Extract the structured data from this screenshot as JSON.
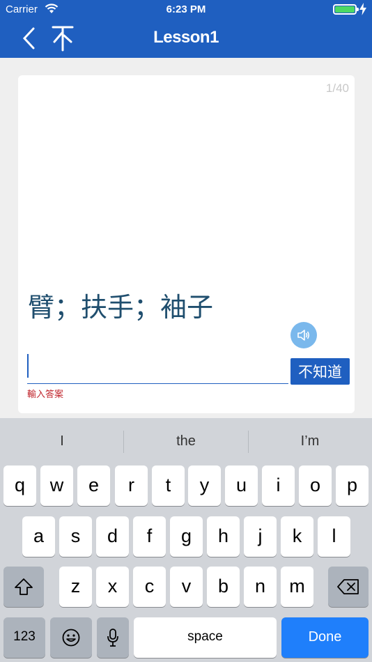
{
  "status_bar": {
    "carrier": "Carrier",
    "time": "6:23 PM"
  },
  "nav": {
    "title": "Lesson1"
  },
  "card": {
    "counter": "1/40",
    "prompt": "臂；扶手；袖子",
    "dont_know_label": "不知道",
    "answer_hint": "輸入答案",
    "answer_value": ""
  },
  "keyboard": {
    "suggestions": [
      "I",
      "the",
      "I’m"
    ],
    "row1": [
      "q",
      "w",
      "e",
      "r",
      "t",
      "y",
      "u",
      "i",
      "o",
      "p"
    ],
    "row2": [
      "a",
      "s",
      "d",
      "f",
      "g",
      "h",
      "j",
      "k",
      "l"
    ],
    "row3": [
      "z",
      "x",
      "c",
      "v",
      "b",
      "n",
      "m"
    ],
    "numbers_label": "123",
    "space_label": "space",
    "done_label": "Done"
  },
  "colors": {
    "nav_bar": "#1f5fc0",
    "prompt_text": "#1f4e6e",
    "hint_text": "#c0262d",
    "speaker_button": "#7ab8ec",
    "done_key": "#1f7ffb"
  }
}
